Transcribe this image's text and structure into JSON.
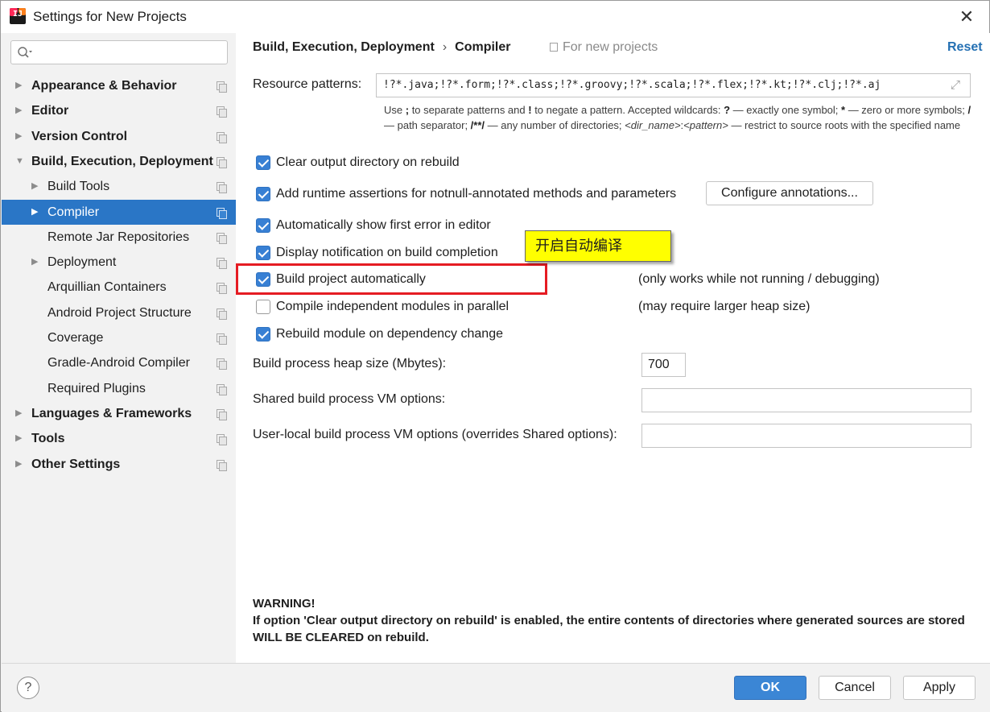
{
  "window": {
    "title": "Settings for New Projects",
    "close_icon": "close-icon"
  },
  "sidebar": {
    "search_placeholder": "",
    "items": [
      {
        "label": "Appearance & Behavior",
        "level": 0,
        "bold": true,
        "arrow": "right"
      },
      {
        "label": "Editor",
        "level": 0,
        "bold": true,
        "arrow": "right"
      },
      {
        "label": "Version Control",
        "level": 0,
        "bold": true,
        "arrow": "right"
      },
      {
        "label": "Build, Execution, Deployment",
        "level": 0,
        "bold": true,
        "arrow": "down"
      },
      {
        "label": "Build Tools",
        "level": 1,
        "bold": false,
        "arrow": "right"
      },
      {
        "label": "Compiler",
        "level": 1,
        "bold": false,
        "arrow": "right",
        "selected": true
      },
      {
        "label": "Remote Jar Repositories",
        "level": 1,
        "bold": false,
        "arrow": ""
      },
      {
        "label": "Deployment",
        "level": 1,
        "bold": false,
        "arrow": "right"
      },
      {
        "label": "Arquillian Containers",
        "level": 1,
        "bold": false,
        "arrow": ""
      },
      {
        "label": "Android Project Structure",
        "level": 1,
        "bold": false,
        "arrow": ""
      },
      {
        "label": "Coverage",
        "level": 1,
        "bold": false,
        "arrow": ""
      },
      {
        "label": "Gradle-Android Compiler",
        "level": 1,
        "bold": false,
        "arrow": ""
      },
      {
        "label": "Required Plugins",
        "level": 1,
        "bold": false,
        "arrow": ""
      },
      {
        "label": "Languages & Frameworks",
        "level": 0,
        "bold": true,
        "arrow": "right"
      },
      {
        "label": "Tools",
        "level": 0,
        "bold": true,
        "arrow": "right"
      },
      {
        "label": "Other Settings",
        "level": 0,
        "bold": true,
        "arrow": "right"
      }
    ]
  },
  "header": {
    "crumb_parent": "Build, Execution, Deployment",
    "crumb_sep": "›",
    "crumb_current": "Compiler",
    "scope": "For new projects",
    "reset": "Reset"
  },
  "resource": {
    "label": "Resource patterns:",
    "value": "!?*.java;!?*.form;!?*.class;!?*.groovy;!?*.scala;!?*.flex;!?*.kt;!?*.clj;!?*.aj",
    "hint_parts": {
      "p1": "Use ",
      "b1": ";",
      "p2": " to separate patterns and ",
      "b2": "!",
      "p3": " to negate a pattern. Accepted wildcards: ",
      "b3": "?",
      "p4": " — exactly one symbol; ",
      "b4": "*",
      "p5": " — zero or more symbols; ",
      "b5": "/",
      "p6": " — path separator; ",
      "b6": "/**/",
      "p7": " — any number of directories; ",
      "i1": "<dir_name>",
      "p8": ":",
      "i2": "<pattern>",
      "p9": " — restrict to source roots with the specified name"
    }
  },
  "options": {
    "clear_output": {
      "label": "Clear output directory on rebuild",
      "checked": true
    },
    "runtime_assertions": {
      "label": "Add runtime assertions for notnull-annotated methods and parameters",
      "checked": true
    },
    "configure_annotations": "Configure annotations...",
    "show_first_error": {
      "label": "Automatically show first error in editor",
      "checked": true
    },
    "notify_build": {
      "label": "Display notification on build completion",
      "checked": true
    },
    "build_auto": {
      "label": "Build project automatically",
      "checked": true,
      "note": "(only works while not running / debugging)"
    },
    "compile_parallel": {
      "label": "Compile independent modules in parallel",
      "checked": false,
      "note": "(may require larger heap size)"
    },
    "rebuild_dep": {
      "label": "Rebuild module on dependency change",
      "checked": true
    }
  },
  "fields": {
    "heap_label": "Build process heap size (Mbytes):",
    "heap_value": "700",
    "shared_vm_label": "Shared build process VM options:",
    "shared_vm_value": "",
    "user_vm_label": "User-local build process VM options (overrides Shared options):",
    "user_vm_value": ""
  },
  "annotation": {
    "callout_text": "开启自动编译",
    "highlight_color": "#e51c23",
    "callout_color": "#ffff00"
  },
  "warning": {
    "title": "WARNING!",
    "body": "If option 'Clear output directory on rebuild' is enabled, the entire contents of directories where generated sources are stored WILL BE CLEARED on rebuild."
  },
  "footer": {
    "help": "?",
    "ok": "OK",
    "cancel": "Cancel",
    "apply": "Apply"
  },
  "colors": {
    "selection": "#2a76c6",
    "accent": "#3880d4",
    "link": "#2470b3"
  }
}
